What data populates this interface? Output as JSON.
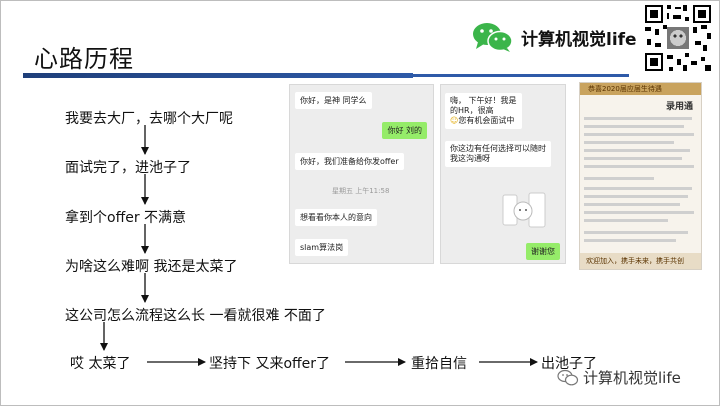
{
  "slide": {
    "title": "心路历程",
    "brand": {
      "name": "计算机视觉life",
      "icon": "wechat-icon"
    },
    "watermark": {
      "text": "计算机视觉life",
      "icon": "wechat-icon"
    },
    "steps": {
      "s1": "我要去大厂，去哪个大厂呢",
      "s2": "面试完了，进池子了",
      "s3": "拿到个offer 不满意",
      "s4": "为啥这么难啊 我还是太菜了",
      "s5": "这公司怎么流程这么长 一看就很难 不面了",
      "s6": "哎 太菜了",
      "s7": "坚持下 又来offer了",
      "s8": "重拾自信",
      "s9": "出池子了"
    },
    "chat1": {
      "msg1": "你好，是神        同学么",
      "msg2": "你好 刘的",
      "msg3": "你好，我们准备给你发offer",
      "timestamp": "星期五 上午11:58",
      "msg4": "想看看你本人的意向",
      "msg5": "slam算法岗"
    },
    "chat2": {
      "msg1": "嗨，       下午好！我是",
      "msg2": "的HR，很高",
      "msg3": "您有机会面试中",
      "msg4": "你这边有任何选择可以随时",
      "msg5": "我这沟通呀",
      "msg6": "谢谢您"
    },
    "doc": {
      "header": "恭喜2020届应届生待遇",
      "heading": "录用通",
      "footer": "欢迎加入，携手未来，携手共创"
    },
    "colors": {
      "accent": "#1f3f7a",
      "wechat_green": "#3bb54a",
      "bubble_green": "#95ec69"
    }
  }
}
